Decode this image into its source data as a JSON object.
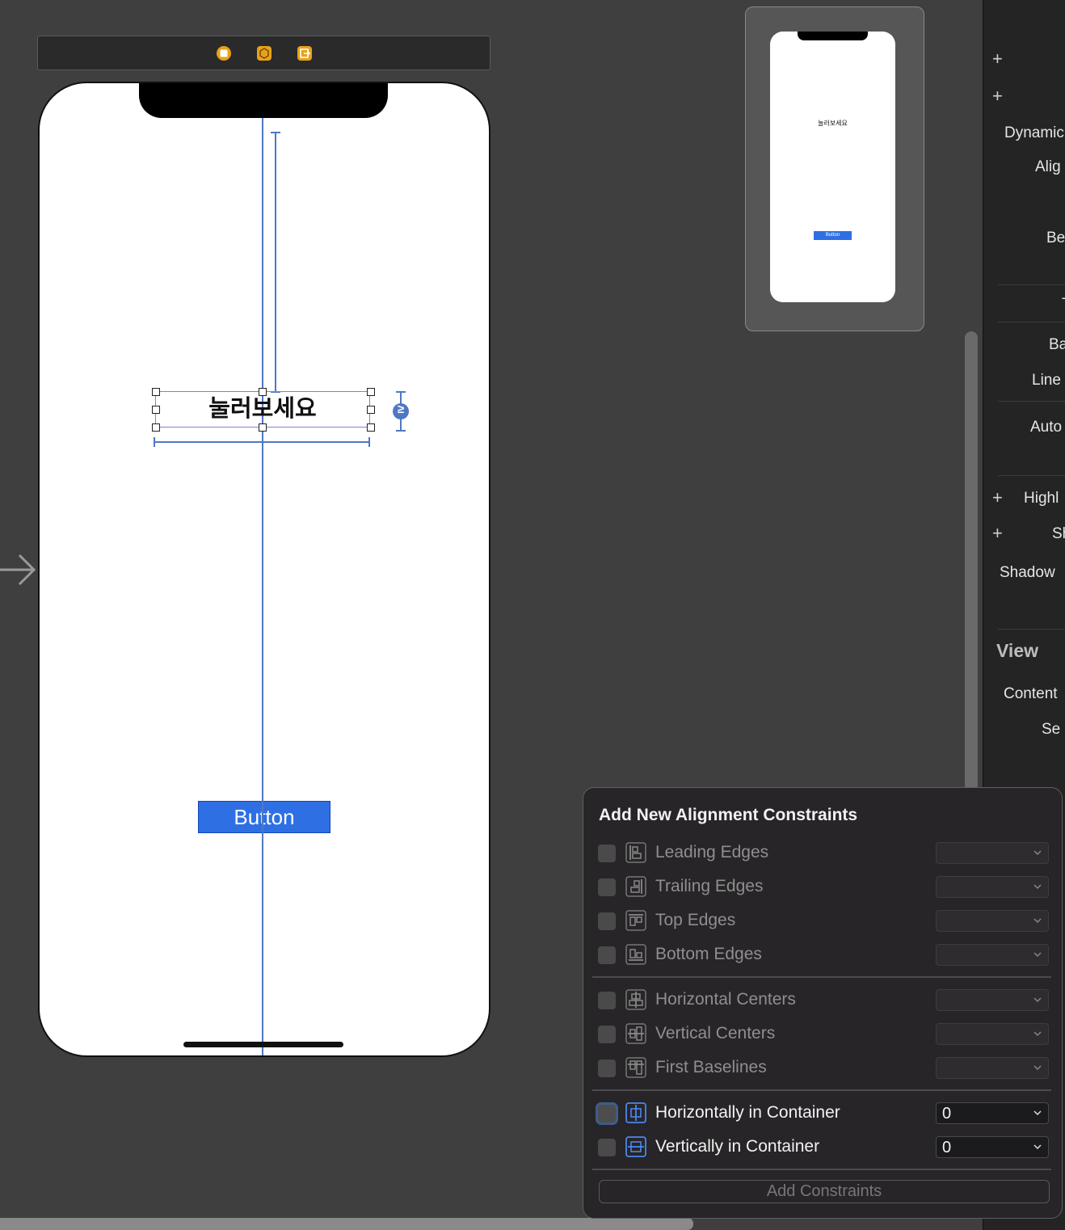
{
  "scene_bar": {
    "icons": [
      "view-controller-icon",
      "first-responder-icon",
      "exit-icon"
    ]
  },
  "canvas": {
    "label_text": "눌러보세요",
    "button_text": "Button",
    "constraint_badge": "≥"
  },
  "preview": {
    "label_text": "눌러보세요",
    "button_text": "Button"
  },
  "inspector": {
    "labels": [
      "Dynamic",
      "Alig",
      "Be",
      "T",
      "Ba",
      "Line",
      "Auto",
      "Highl",
      "Sh",
      "Shadow"
    ],
    "view_section": "View",
    "view_labels": [
      "Content",
      "Se"
    ]
  },
  "popover": {
    "title": "Add New Alignment Constraints",
    "rows": [
      {
        "label": "Leading Edges",
        "value": "",
        "enabled": false
      },
      {
        "label": "Trailing Edges",
        "value": "",
        "enabled": false
      },
      {
        "label": "Top Edges",
        "value": "",
        "enabled": false
      },
      {
        "label": "Bottom Edges",
        "value": "",
        "enabled": false
      },
      {
        "label": "Horizontal Centers",
        "value": "",
        "enabled": false
      },
      {
        "label": "Vertical Centers",
        "value": "",
        "enabled": false
      },
      {
        "label": "First Baselines",
        "value": "",
        "enabled": false
      },
      {
        "label": "Horizontally in Container",
        "value": "0",
        "enabled": true
      },
      {
        "label": "Vertically in Container",
        "value": "0",
        "enabled": true
      }
    ],
    "add_button": "Add Constraints"
  },
  "colors": {
    "accent": "#2f6fe4",
    "guide": "#4f78c4",
    "selection": "#7d7fe0"
  }
}
